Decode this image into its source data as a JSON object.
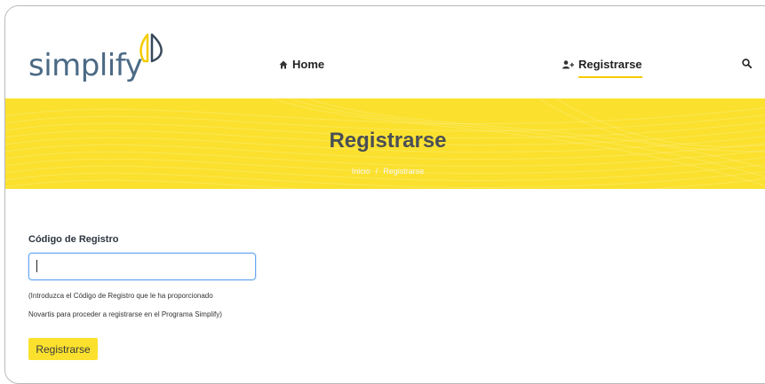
{
  "brand": {
    "logo_text": "simplify"
  },
  "nav": {
    "home_label": "Home",
    "register_label": "Registrarse"
  },
  "banner": {
    "title": "Registrarse",
    "breadcrumb": {
      "home": "Inicio",
      "separator": "/",
      "current": "Registrarse"
    }
  },
  "form": {
    "field_label": "Código de Registro",
    "input_value": "",
    "help_line1": "(Introduzca el Código de Registro que le ha proporcionado",
    "help_line2": "Novartis para proceder a registrarse en el Programa Simplify)",
    "submit_label": "Registrarse"
  },
  "colors": {
    "accent": "#fbe12e",
    "logo": "#4b6a85",
    "title": "#4a4f55"
  },
  "icons": {
    "home": "home-icon",
    "register": "add-user-icon",
    "search": "search-icon"
  }
}
